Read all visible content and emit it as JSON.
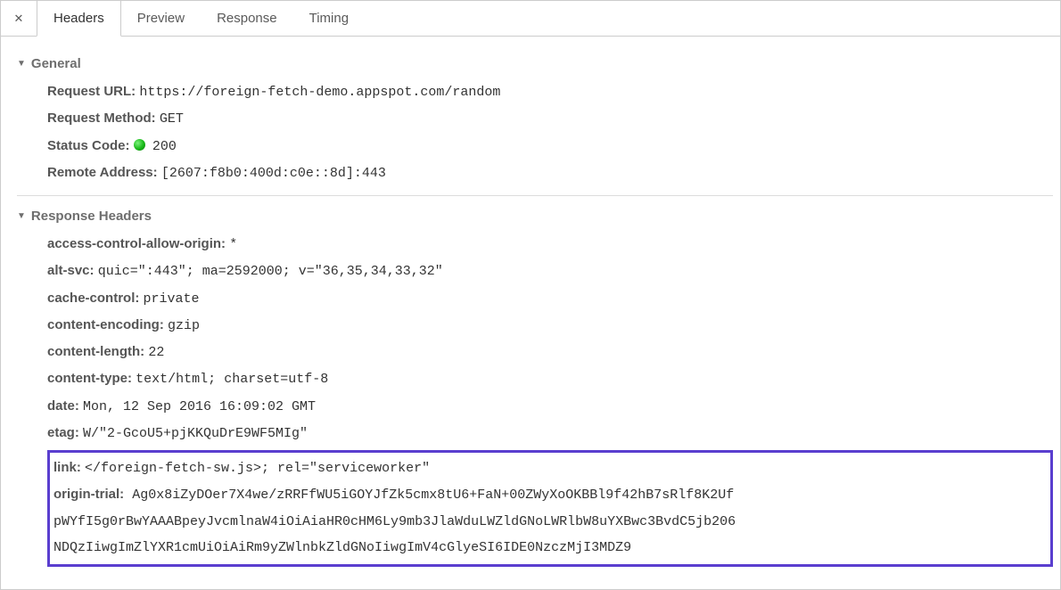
{
  "tabs": {
    "close_icon": "✕",
    "items": [
      {
        "label": "Headers",
        "active": true
      },
      {
        "label": "Preview",
        "active": false
      },
      {
        "label": "Response",
        "active": false
      },
      {
        "label": "Timing",
        "active": false
      }
    ]
  },
  "general": {
    "title": "General",
    "request_url_label": "Request URL:",
    "request_url_value": "https://foreign-fetch-demo.appspot.com/random",
    "request_method_label": "Request Method:",
    "request_method_value": "GET",
    "status_code_label": "Status Code:",
    "status_code_value": "200",
    "remote_address_label": "Remote Address:",
    "remote_address_value": "[2607:f8b0:400d:c0e::8d]:443"
  },
  "response_headers": {
    "title": "Response Headers",
    "items": [
      {
        "key": "access-control-allow-origin:",
        "value": "*"
      },
      {
        "key": "alt-svc:",
        "value": "quic=\":443\"; ma=2592000; v=\"36,35,34,33,32\""
      },
      {
        "key": "cache-control:",
        "value": "private"
      },
      {
        "key": "content-encoding:",
        "value": "gzip"
      },
      {
        "key": "content-length:",
        "value": "22"
      },
      {
        "key": "content-type:",
        "value": "text/html; charset=utf-8"
      },
      {
        "key": "date:",
        "value": "Mon, 12 Sep 2016 16:09:02 GMT"
      },
      {
        "key": "etag:",
        "value": "W/\"2-GcoU5+pjKKQuDrE9WF5MIg\""
      }
    ],
    "highlight": {
      "link_key": "link:",
      "link_value": "</foreign-fetch-sw.js>; rel=\"serviceworker\"",
      "origin_trial_key": "origin-trial:",
      "origin_trial_value_line1": "Ag0x8iZyDOer7X4we/zRRFfWU5iGOYJfZk5cmx8tU6+FaN+00ZWyXoOKBBl9f42hB7sRlf8K2Uf",
      "origin_trial_value_line2": "pWYfI5g0rBwYAAABpeyJvcmlnaW4iOiAiaHR0cHM6Ly9mb3JlaWduLWZldGNoLWRlbW8uYXBwc3BvdC5jb206",
      "origin_trial_value_line3": "NDQzIiwgImZlYXR1cmUiOiAiRm9yZWlnbkZldGNoIiwgImV4cGlyeSI6IDE0NzczMjI3MDZ9"
    }
  }
}
